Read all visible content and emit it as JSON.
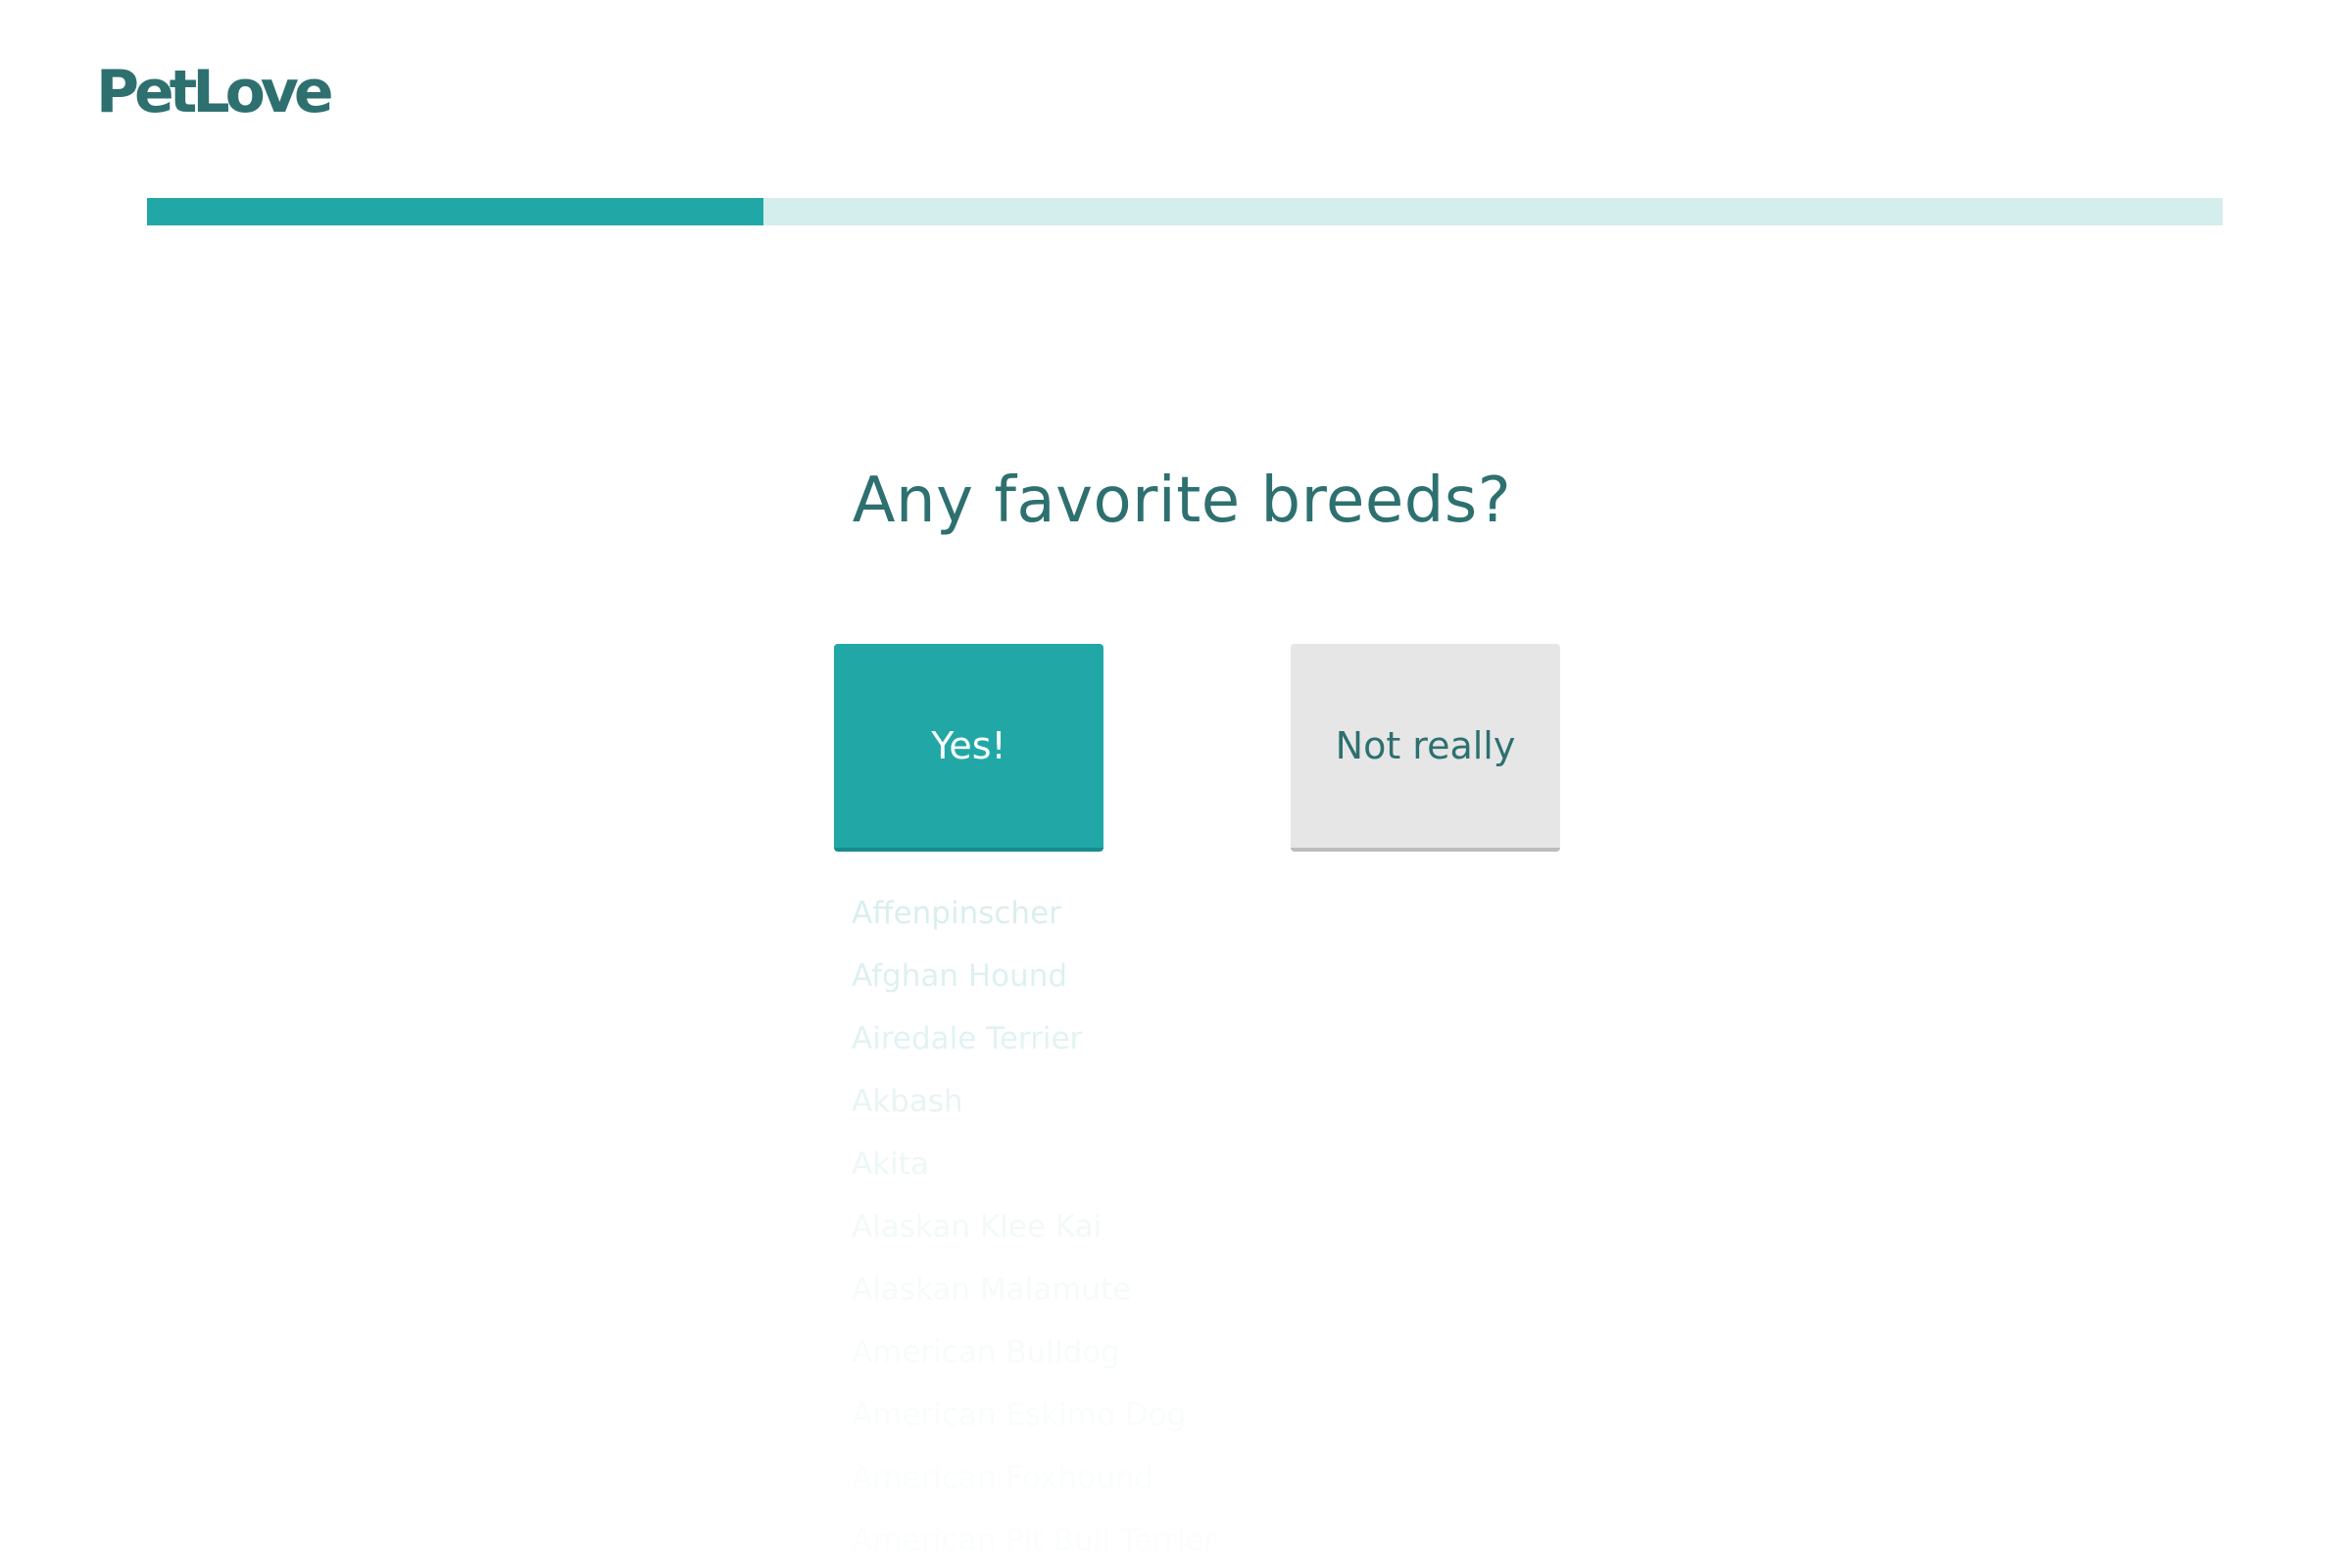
{
  "brand": {
    "logo_text": "PetLove"
  },
  "progress": {
    "fraction": 0.297,
    "fill_color": "#22a7a7",
    "track_color": "#d4eded"
  },
  "question": {
    "title": "Any favorite breeds?"
  },
  "choices": {
    "yes_label": "Yes!",
    "no_label": "Not really"
  },
  "breeds": [
    "Affenpinscher",
    "Afghan Hound",
    "Airedale Terrier",
    "Akbash",
    "Akita",
    "Alaskan Klee Kai",
    "Alaskan Malamute",
    "American Bulldog",
    "American Eskimo Dog",
    "American Foxhound",
    "American Pit Bull Terrier"
  ],
  "colors": {
    "brand_text": "#2e7070",
    "accent": "#22a7a7",
    "secondary_button": "#e6e6e6"
  }
}
